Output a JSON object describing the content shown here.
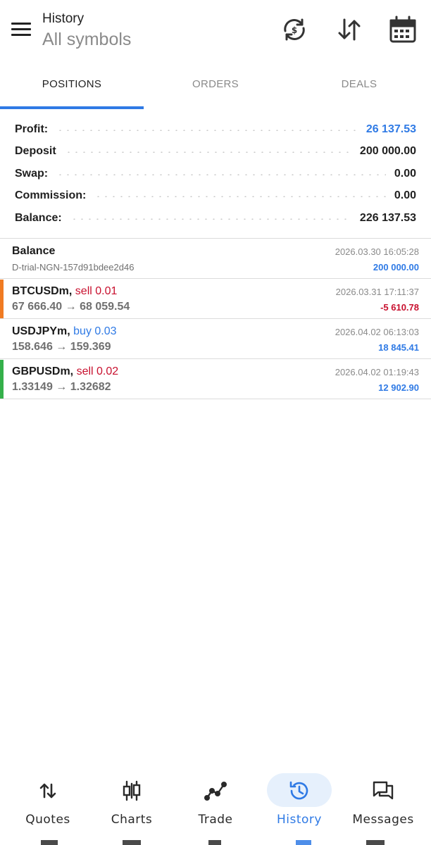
{
  "header": {
    "title": "History",
    "subtitle": "All symbols",
    "icons": [
      "menu-icon",
      "sync-icon",
      "sort-icon",
      "calendar-icon"
    ]
  },
  "tabs": [
    {
      "label": "POSITIONS",
      "active": true
    },
    {
      "label": "ORDERS",
      "active": false
    },
    {
      "label": "DEALS",
      "active": false
    }
  ],
  "summary": {
    "profit": {
      "label": "Profit:",
      "value": "26 137.53"
    },
    "deposit": {
      "label": "Deposit",
      "value": "200 000.00"
    },
    "swap": {
      "label": "Swap:",
      "value": "0.00"
    },
    "commission": {
      "label": "Commission:",
      "value": "0.00"
    },
    "balance": {
      "label": "Balance:",
      "value": "226 137.53"
    }
  },
  "deals": [
    {
      "symbol": "Balance",
      "side": "",
      "sub": "D-trial-NGN-157d91bdee2d46",
      "time": "2026.03.30 16:05:28",
      "amount": "200 000.00",
      "amount_type": "pos",
      "bar": ""
    },
    {
      "symbol": "BTCUSDm,",
      "side": "sell 0.01",
      "sub": "67 666.40 → 68 059.54",
      "time": "2026.03.31 17:11:37",
      "amount": "-5 610.78",
      "amount_type": "neg",
      "bar": "#f07b22"
    },
    {
      "symbol": "USDJPYm,",
      "side": "buy 0.03",
      "sub": "158.646 → 159.369",
      "time": "2026.04.02 06:13:03",
      "amount": "18 845.41",
      "amount_type": "pos",
      "bar": ""
    },
    {
      "symbol": "GBPUSDm,",
      "side": "sell 0.02",
      "sub": "1.33149 → 1.32682",
      "time": "2026.04.02 01:19:43",
      "amount": "12 902.90",
      "amount_type": "pos",
      "bar": "#34b04a"
    }
  ],
  "nav": [
    {
      "label": "Quotes",
      "icon": "quotes-icon",
      "active": false
    },
    {
      "label": "Charts",
      "icon": "charts-icon",
      "active": false
    },
    {
      "label": "Trade",
      "icon": "trade-icon",
      "active": false
    },
    {
      "label": "History",
      "icon": "history-icon",
      "active": true
    },
    {
      "label": "Messages",
      "icon": "messages-icon",
      "active": false
    }
  ],
  "colors": {
    "accent": "#2f7ae5",
    "negative": "#c8102e",
    "sell_bar": "#f07b22",
    "profit_bar": "#34b04a"
  }
}
